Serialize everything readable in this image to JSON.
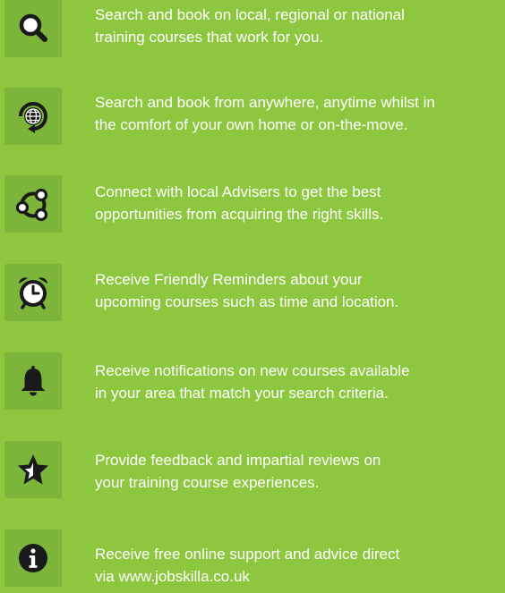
{
  "features": [
    {
      "icon": "search-icon",
      "lines": [
        "Search and book on local, regional or national",
        "training courses that work for you."
      ]
    },
    {
      "icon": "globe-refresh-icon",
      "lines": [
        "Search and book from anywhere, anytime whilst in",
        "the comfort of your own home or on-the-move."
      ]
    },
    {
      "icon": "connect-network-icon",
      "lines": [
        "Connect with local Advisers to get the best",
        "opportunities from acquiring the right skills."
      ]
    },
    {
      "icon": "alarm-clock-icon",
      "lines": [
        "Receive Friendly Reminders about your",
        "upcoming courses such as time and location."
      ]
    },
    {
      "icon": "bell-icon",
      "lines": [
        "Receive notifications on new courses available",
        "in your area that match your search criteria."
      ]
    },
    {
      "icon": "star-half-icon",
      "lines": [
        "Provide feedback and impartial reviews on",
        "your training course experiences."
      ]
    },
    {
      "icon": "info-icon",
      "lines": [
        "Receive free online support and advice direct",
        "via www.jobskilla.co.uk"
      ]
    }
  ],
  "colors": {
    "background": "#8dc63f",
    "tile": "#7bb53a",
    "icon": "#1a1a1a",
    "text": "#ffffff"
  }
}
